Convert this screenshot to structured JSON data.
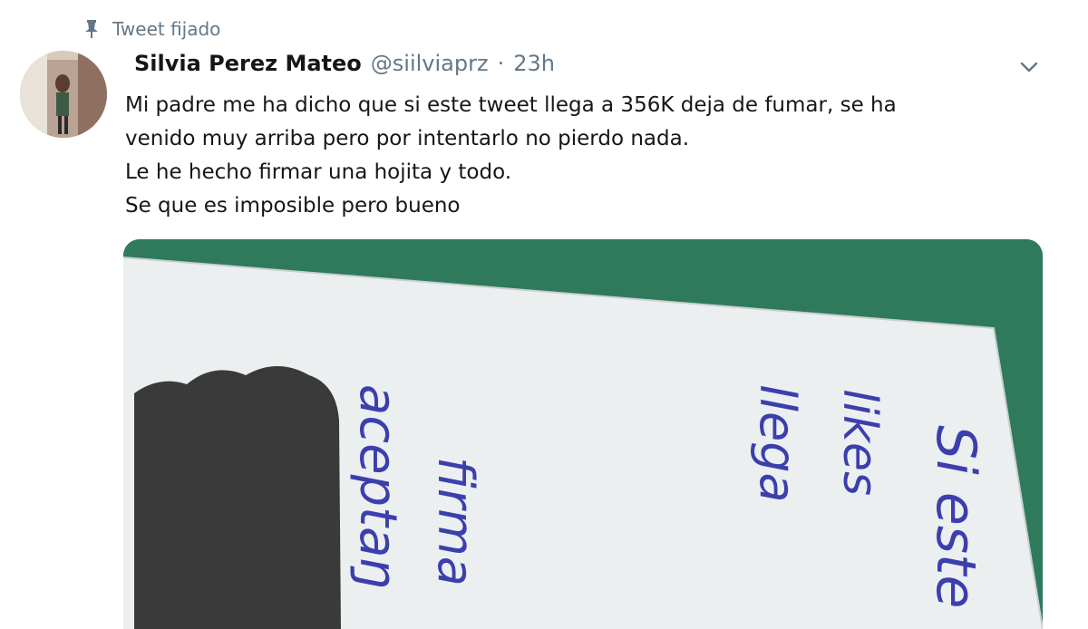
{
  "pinned": {
    "label": "Tweet fijado",
    "icon": "pin-icon"
  },
  "tweet": {
    "author": {
      "name": "Silvia Perez Mateo",
      "handle": "@siilviaprz",
      "avatar_icon": "avatar"
    },
    "separator": "·",
    "timestamp": "23h",
    "menu_icon": "chevron-down-icon",
    "text_lines": [
      "Mi padre me ha dicho que si este tweet llega a 356K deja de fumar, se ha",
      "venido muy arriba pero por intentarlo no pierdo nada.",
      "Le he hecho firmar una hojita y todo.",
      "Se que es imposible pero bueno"
    ],
    "media": {
      "handwriting": [
        "Si este",
        "likes",
        "llega",
        "firma",
        "aceptaŋ"
      ],
      "colors": {
        "background": "#2f7a5c",
        "paper": "#eceff0",
        "ink": "#3b3fae",
        "redaction": "#3a3a3a"
      }
    }
  },
  "colors": {
    "text": "#14171a",
    "secondary": "#657786"
  }
}
